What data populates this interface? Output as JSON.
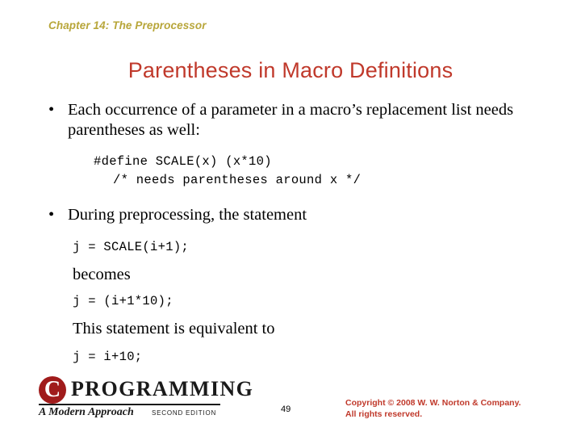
{
  "header": {
    "chapter": "Chapter 14: The Preprocessor"
  },
  "title": "Parentheses in Macro Definitions",
  "content": {
    "bullet1": "Each occurrence of a parameter in a macro’s replacement list needs parentheses as well:",
    "code1": "#define SCALE(x) (x*10)",
    "code1b": "/* needs parentheses around x */",
    "bullet2": "During preprocessing, the statement",
    "code2": "j = SCALE(i+1);",
    "becomes": "becomes",
    "code3": "j = (i+1*10);",
    "equivalent": "This statement is equivalent to",
    "code4": "j = i+10;",
    "bullet_char": "•"
  },
  "footer": {
    "logo_letter": "C",
    "logo_word": "PROGRAMMING",
    "logo_subtitle": "A Modern Approach",
    "logo_edition": "SECOND EDITION",
    "page_number": "49",
    "copyright_line1": "Copyright © 2008 W. W. Norton & Company.",
    "copyright_line2": "All rights reserved."
  }
}
